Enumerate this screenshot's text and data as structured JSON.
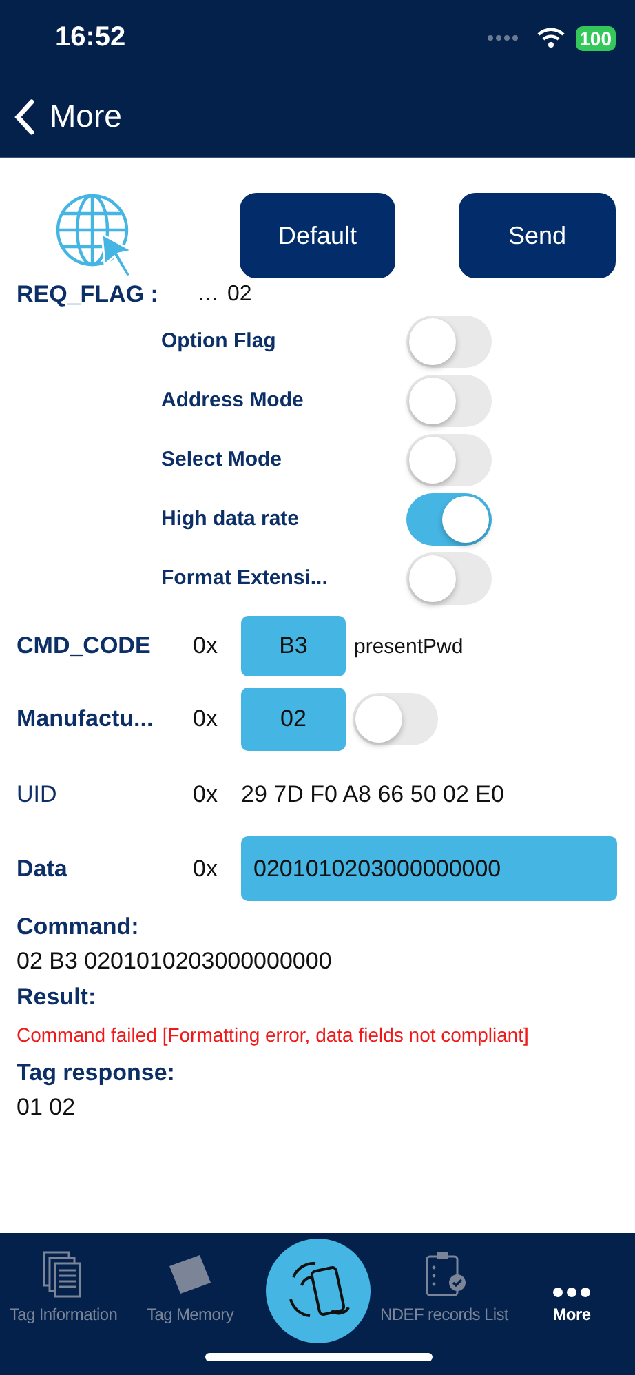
{
  "status_bar": {
    "time": "16:52",
    "battery": "100"
  },
  "nav": {
    "back_label": "More"
  },
  "toolbar": {
    "buttons": [
      "Default",
      "Send"
    ]
  },
  "req_flag": {
    "label": "REQ_FLAG :",
    "prefix": "…",
    "value": "02"
  },
  "flags": [
    {
      "label": "Option Flag",
      "on": false
    },
    {
      "label": "Address Mode",
      "on": false
    },
    {
      "label": "Select Mode",
      "on": false
    },
    {
      "label": "High data rate",
      "on": true
    },
    {
      "label": "Format Extensi...",
      "on": false
    }
  ],
  "fields": [
    {
      "kind": "code",
      "label": "CMD_CODE",
      "prefix": "0x",
      "value": "B3",
      "name": "presentPwd"
    },
    {
      "kind": "switch",
      "label": "Manufactu...",
      "prefix": "0x",
      "value": "02",
      "on": false
    },
    {
      "kind": "text",
      "label": "UID",
      "prefix": "0x",
      "value": "29 7D F0 A8 66 50 02 E0"
    },
    {
      "kind": "wide",
      "label": "Data",
      "prefix": "0x",
      "value": "0201010203000000000"
    }
  ],
  "output": [
    {
      "kind": "plain",
      "label": "Command:",
      "value": "02 B3 0201010203000000000"
    },
    {
      "kind": "error",
      "label": "Result:",
      "value": "Command failed [Formatting error, data fields not compliant]"
    },
    {
      "kind": "plain",
      "label": "Tag response:",
      "value": "01 02"
    }
  ],
  "tabbar": {
    "tabs": [
      {
        "kind": "info",
        "label": "Tag Information",
        "selected": false
      },
      {
        "kind": "memory",
        "label": "Tag Memory",
        "selected": false
      },
      {
        "kind": "scan",
        "selected": false
      },
      {
        "kind": "ndef",
        "label": "NDEF records List",
        "selected": false
      },
      {
        "kind": "more",
        "label": "More",
        "selected": true
      }
    ]
  }
}
